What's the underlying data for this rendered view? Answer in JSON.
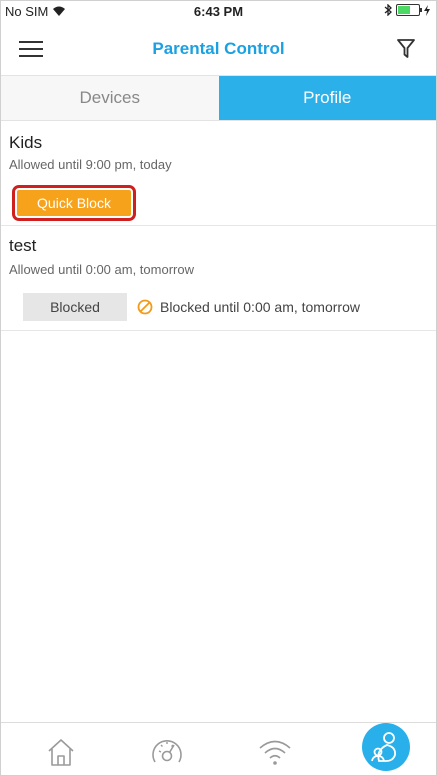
{
  "status_bar": {
    "carrier": "No SIM",
    "time": "6:43 PM"
  },
  "header": {
    "title": "Parental Control"
  },
  "tabs": [
    {
      "label": "Devices",
      "active": false
    },
    {
      "label": "Profile",
      "active": true
    }
  ],
  "profiles": [
    {
      "name": "Kids",
      "schedule": "Allowed until 9:00 pm, today",
      "action_label": "Quick Block"
    },
    {
      "name": "test",
      "schedule": "Allowed until 0:00 am, tomorrow",
      "action_label": "Blocked",
      "status_text": "Blocked until 0:00 am, tomorrow"
    }
  ],
  "colors": {
    "accent": "#2bb0ea",
    "quick_block": "#f7a21b",
    "highlight": "#cf1f1f"
  },
  "bottom_nav": {
    "items": [
      {
        "icon": "home-icon",
        "active": false
      },
      {
        "icon": "speedometer-icon",
        "active": false
      },
      {
        "icon": "wifi-icon",
        "active": false
      },
      {
        "icon": "parental-control-icon",
        "active": true
      }
    ]
  }
}
